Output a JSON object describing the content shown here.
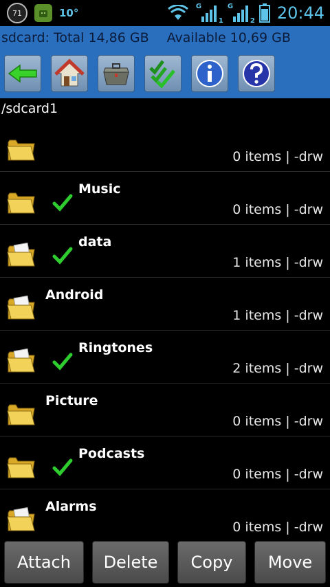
{
  "status_bar": {
    "badge": "71",
    "temperature": "10°",
    "signal1_sub": "1",
    "signal2_sub": "2",
    "signal_label": "G",
    "time": "20:44"
  },
  "storage": {
    "total": "sdcard: Total 14,86 GB",
    "available": "Available 10,69 GB"
  },
  "toolbar": {
    "icons": [
      "back-arrow-icon",
      "home-icon",
      "toolbox-icon",
      "multi-select-icon",
      "info-icon",
      "help-icon"
    ]
  },
  "path": "/sdcard1",
  "files": [
    {
      "name": "",
      "meta": "0 items | -drw",
      "checked": false,
      "has_docs": false
    },
    {
      "name": "Music",
      "meta": "0 items | -drw",
      "checked": true,
      "has_docs": false
    },
    {
      "name": "data",
      "meta": "1 items | -drw",
      "checked": true,
      "has_docs": true
    },
    {
      "name": "Android",
      "meta": "1 items | -drw",
      "checked": false,
      "has_docs": true
    },
    {
      "name": "Ringtones",
      "meta": "2 items | -drw",
      "checked": true,
      "has_docs": true
    },
    {
      "name": "Picture",
      "meta": "0 items | -drw",
      "checked": false,
      "has_docs": false
    },
    {
      "name": "Podcasts",
      "meta": "0 items | -drw",
      "checked": true,
      "has_docs": false
    },
    {
      "name": "Alarms",
      "meta": "0 items | -drw",
      "checked": false,
      "has_docs": true
    }
  ],
  "actions": {
    "attach": "Attach",
    "delete": "Delete",
    "copy": "Copy",
    "move": "Move"
  },
  "colors": {
    "accent_blue": "#2a6fbd",
    "status_cyan": "#5ec3e8",
    "check_green": "#2ecc2e",
    "folder_yellow": "#f1c93a"
  }
}
